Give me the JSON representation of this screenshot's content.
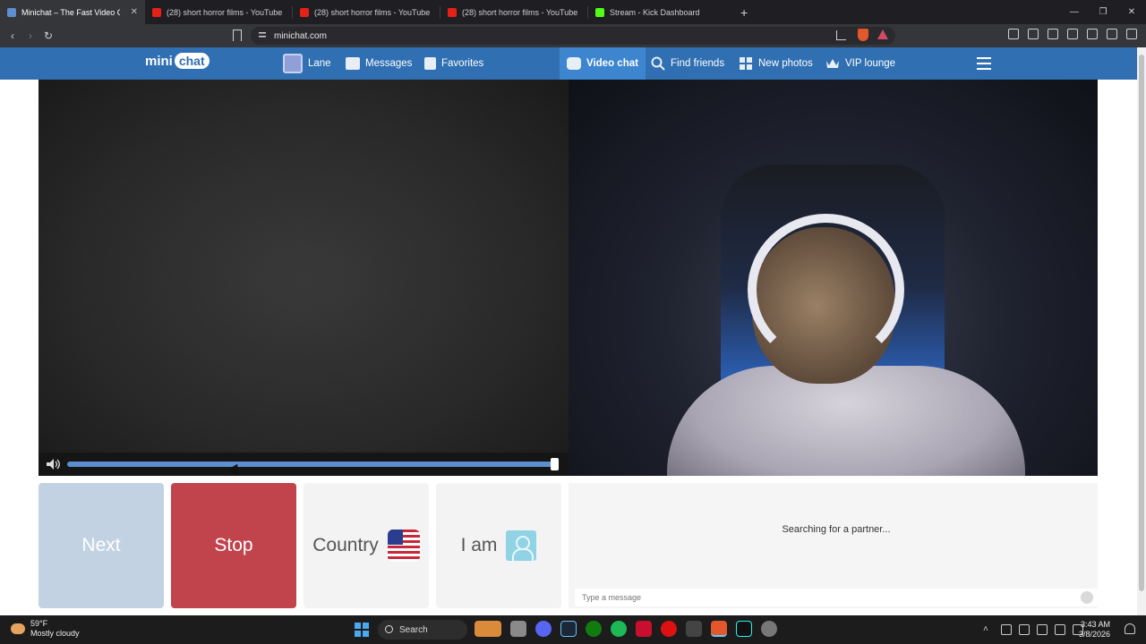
{
  "browser": {
    "tabs": [
      {
        "title": "Minichat – The Fast Video Ch",
        "active": true,
        "favicon": "minichat-icon",
        "color": "#5b8fd0"
      },
      {
        "title": "(28) short horror films - YouTube",
        "active": false,
        "favicon": "youtube-icon",
        "color": "#e62117"
      },
      {
        "title": "(28) short horror films - YouTube",
        "active": false,
        "favicon": "youtube-icon",
        "color": "#e62117"
      },
      {
        "title": "(28) short horror films - YouTube",
        "active": false,
        "favicon": "youtube-icon",
        "color": "#e62117"
      },
      {
        "title": "Stream - Kick Dashboard",
        "active": false,
        "favicon": "kick-icon",
        "color": "#53fc18"
      }
    ],
    "new_tab": "+",
    "window_controls": {
      "minimize": "—",
      "maximize": "❐",
      "close": "✕"
    },
    "url": "minichat.com"
  },
  "site": {
    "logo_part1": "mini",
    "logo_part2": "chat",
    "nav": {
      "profile": "Lane",
      "messages": "Messages",
      "favorites": "Favorites",
      "video_chat": "Video chat",
      "find_friends": "Find friends",
      "new_photos": "New photos",
      "vip": "VIP lounge"
    },
    "accent": "#2f6fb2"
  },
  "player": {
    "volume_level": 1.0
  },
  "controls": {
    "next": "Next",
    "stop": "Stop",
    "country": "Country",
    "i_am": "I am"
  },
  "chat": {
    "status": "Searching for a partner...",
    "placeholder": "Type a message"
  },
  "taskbar": {
    "temp": "59°F",
    "weather": "Mostly cloudy",
    "search": "Search",
    "time": "3:43 AM",
    "date": "3/8/2026"
  }
}
